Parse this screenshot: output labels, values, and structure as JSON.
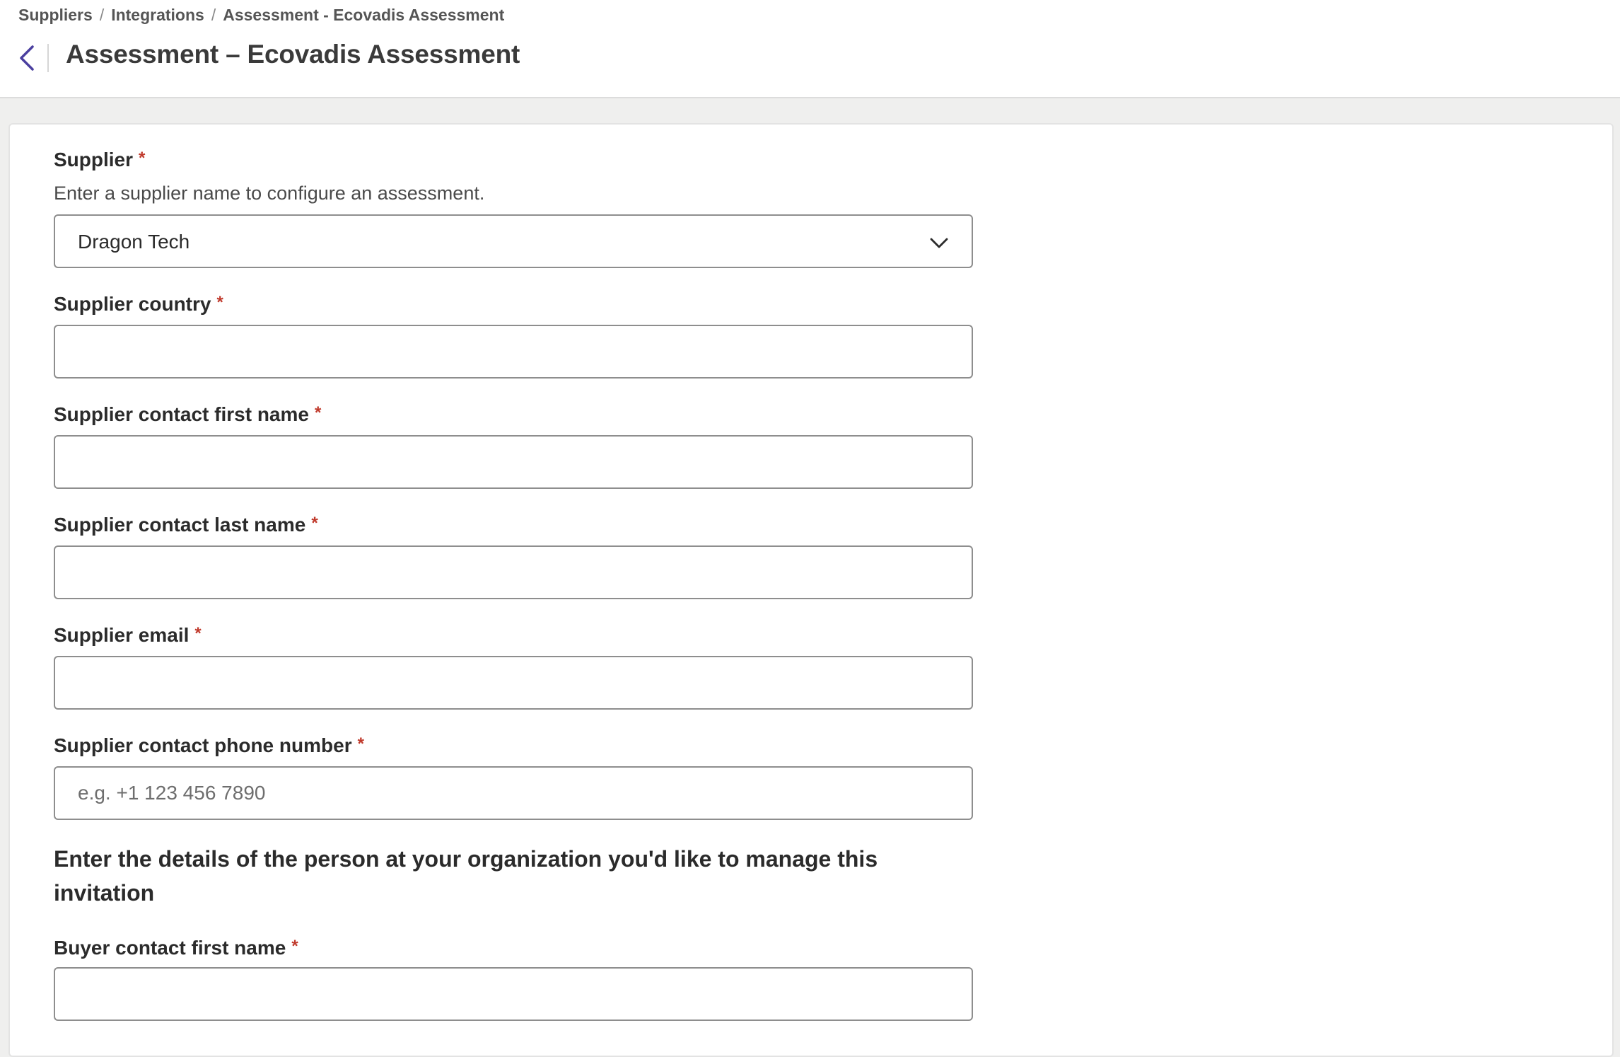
{
  "breadcrumb": {
    "items": [
      "Suppliers",
      "Integrations",
      "Assessment - Ecovadis Assessment"
    ],
    "separator": "/"
  },
  "header": {
    "title": "Assessment – Ecovadis Assessment",
    "back_icon": "chevron-left-icon"
  },
  "form": {
    "required_marker": "*",
    "supplier": {
      "label": "Supplier",
      "help": "Enter a supplier name to configure an assessment.",
      "value": "Dragon Tech",
      "icon": "chevron-down-icon"
    },
    "supplier_country": {
      "label": "Supplier country",
      "value": ""
    },
    "contact_first_name": {
      "label": "Supplier contact first name",
      "value": ""
    },
    "contact_last_name": {
      "label": "Supplier contact last name",
      "value": ""
    },
    "email": {
      "label": "Supplier email",
      "value": ""
    },
    "phone": {
      "label": "Supplier contact phone number",
      "value": "",
      "placeholder": "e.g. +1 123 456 7890"
    },
    "section_heading": "Enter the details of the person at your organization you'd like to manage this invitation",
    "buyer_first_name": {
      "label": "Buyer contact first name",
      "value": ""
    }
  },
  "colors": {
    "accent": "#4a3f9f",
    "required": "#c0392b",
    "background": "#efefee",
    "border": "#8e8e8e"
  }
}
